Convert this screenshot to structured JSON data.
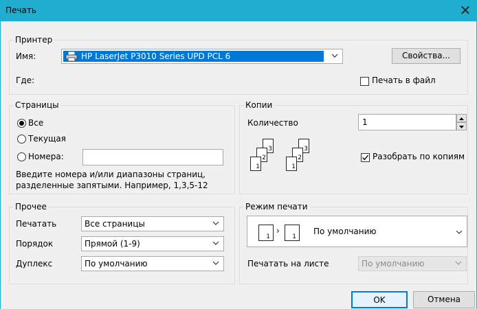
{
  "window": {
    "title": "Печать"
  },
  "printer": {
    "legend": "Принтер",
    "name_label": "Имя:",
    "name_value": "HP LaserJet P3010 Series UPD PCL 6",
    "properties_button": "Свойства...",
    "where_label": "Где:",
    "print_to_file_label": "Печать в файл",
    "print_to_file_checked": false
  },
  "pages": {
    "legend": "Страницы",
    "all_label": "Все",
    "current_label": "Текущая",
    "numbers_label": "Номера:",
    "numbers_value": "",
    "selected": "all",
    "hint_line1": "Введите номера и/или диапазоны страниц,",
    "hint_line2": "разделенные запятыми. Например, 1,3,5-12"
  },
  "copies": {
    "legend": "Копии",
    "count_label": "Количество",
    "count_value": "1",
    "collate_label": "Разобрать по копиям",
    "collate_checked": true,
    "icon_numbers": [
      "3",
      "2",
      "1",
      "3",
      "2",
      "1"
    ]
  },
  "other": {
    "legend": "Прочее",
    "print_label": "Печатать",
    "print_value": "Все страницы",
    "order_label": "Порядок",
    "order_value": "Прямой (1-9)",
    "duplex_label": "Дуплекс",
    "duplex_value": "По умолчанию"
  },
  "print_mode": {
    "legend": "Режим печати",
    "mode_value": "По умолчанию",
    "mode_icon_numbers": [
      "1",
      "1"
    ],
    "per_sheet_label": "Печатать на листе",
    "per_sheet_value": "По умолчанию"
  },
  "buttons": {
    "ok": "OK",
    "cancel": "Отмена"
  },
  "colors": {
    "titlebar": "#1faecf",
    "selection": "#0078d7",
    "ok_border": "#0078d7"
  }
}
